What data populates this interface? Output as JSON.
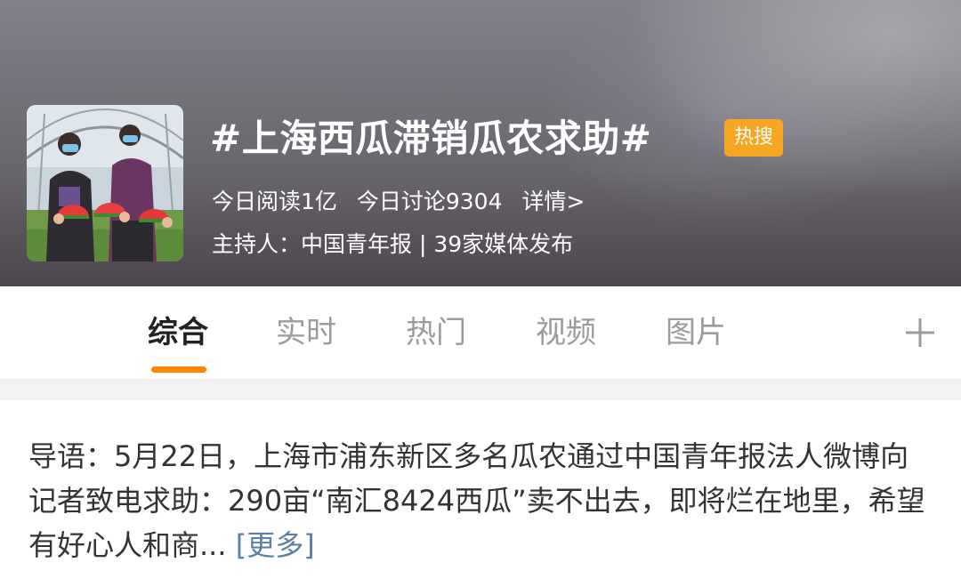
{
  "topic": {
    "title": "#上海西瓜滞销瓜农求助#",
    "badge": "热搜",
    "badge_color": "#f5a623",
    "reads": "今日阅读1亿",
    "discussions": "今日讨论9304",
    "details": "详情>",
    "host": "主持人：中国青年报 | 39家媒体发布",
    "thumbnail_icon": "farmers-with-watermelon-photo"
  },
  "tabs": {
    "items": [
      {
        "label": "综合",
        "active": true
      },
      {
        "label": "实时",
        "active": false
      },
      {
        "label": "热门",
        "active": false
      },
      {
        "label": "视频",
        "active": false
      },
      {
        "label": "图片",
        "active": false
      }
    ],
    "add_icon": "plus-icon",
    "accent_color": "#ff8200"
  },
  "intro": {
    "text": "导语：5月22日，上海市浦东新区多名瓜农通过中国青年报法人微博向记者致电求助：290亩“南汇8424西瓜”卖不出去，即将烂在地里，希望有好心人和商...",
    "more": "[更多]",
    "link_color": "#5b7fa8"
  }
}
